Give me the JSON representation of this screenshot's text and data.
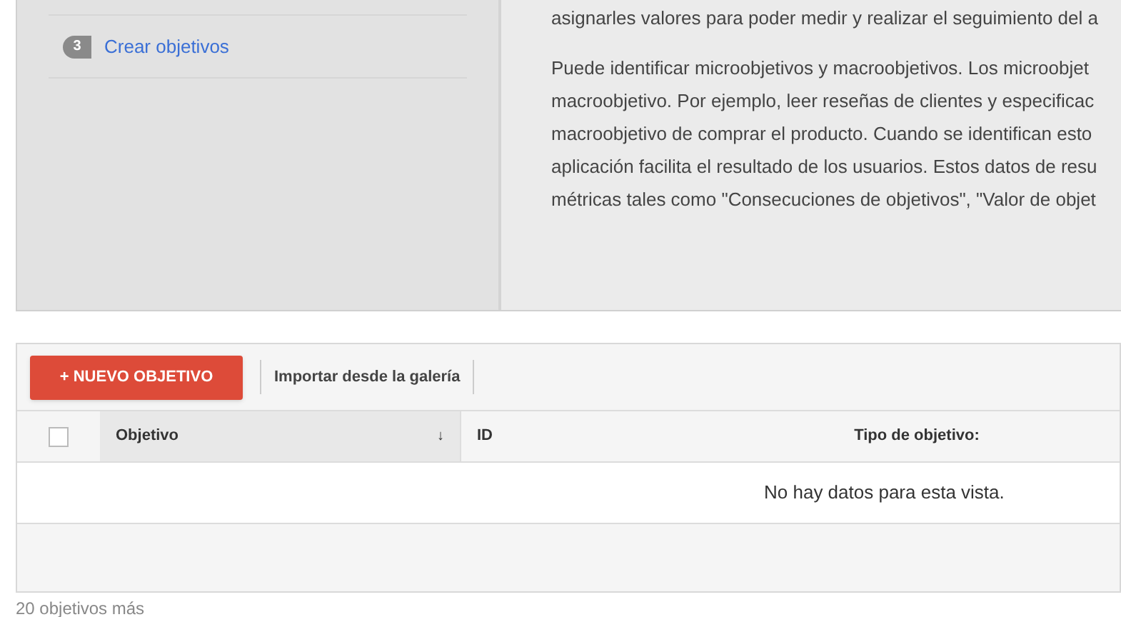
{
  "steps": [
    {
      "number": "3",
      "label": "Crear objetivos"
    }
  ],
  "intro_line": "asignarles valores para poder medir y realizar el seguimiento del a",
  "paragraph_lines": [
    "Puede identificar microobjetivos y macroobjetivos. Los microobjet",
    "macroobjetivo. Por ejemplo, leer reseñas de clientes y especificac",
    "macroobjetivo de comprar el producto. Cuando se identifican esto",
    "aplicación facilita el resultado de los usuarios. Estos datos de resu",
    "métricas tales como \"Consecuciones de objetivos\", \"Valor de objet"
  ],
  "toolbar": {
    "new_button": "+ NUEVO OBJETIVO",
    "import_link": "Importar desde la galería"
  },
  "table": {
    "select_all_checked": false,
    "columns": [
      {
        "label": "Objetivo",
        "sort": "↓",
        "selected": true
      },
      {
        "label": "ID",
        "selected": false
      },
      {
        "label": "Tipo de objetivo:",
        "selected": false
      }
    ],
    "empty_message": "No hay datos para esta vista."
  },
  "more_label": "20 objetivos más"
}
